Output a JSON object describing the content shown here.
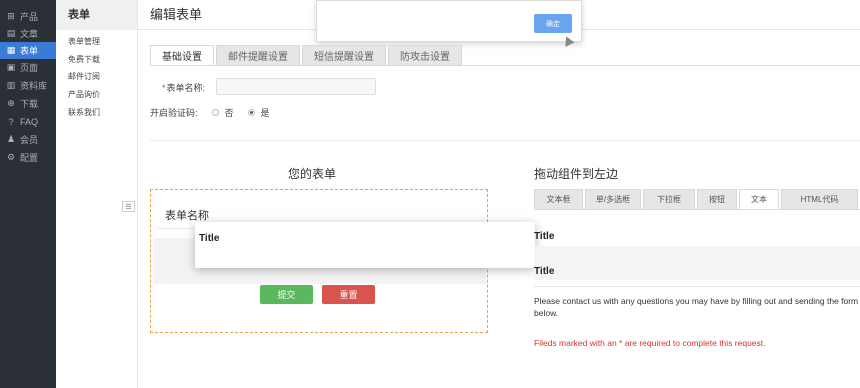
{
  "nav": {
    "items": [
      {
        "icon": "grid-icon",
        "label": "产品"
      },
      {
        "icon": "file-icon",
        "label": "文章"
      },
      {
        "icon": "form-icon",
        "label": "表单"
      },
      {
        "icon": "page-icon",
        "label": "页面"
      },
      {
        "icon": "folder-icon",
        "label": "资料库"
      },
      {
        "icon": "download-icon",
        "label": "下载"
      },
      {
        "icon": "faq-icon",
        "label": "FAQ"
      },
      {
        "icon": "member-icon",
        "label": "会员"
      },
      {
        "icon": "settings-icon",
        "label": "配置"
      }
    ],
    "active_color": "#3a7bd5"
  },
  "sidebar": {
    "header": "表单",
    "items": [
      "表单管理",
      "免费下载",
      "邮件订阅",
      "产品询价",
      "联系我们"
    ]
  },
  "header": {
    "title": "编辑表单"
  },
  "dialog": {
    "confirm_label": "确定"
  },
  "tabs": [
    "基础设置",
    "邮件提醒设置",
    "短信提醒设置",
    "防攻击设置"
  ],
  "form": {
    "name_label": "表单名称:",
    "name_value": "",
    "captcha_label": "开启验证码:",
    "captcha_options": [
      "否",
      "是"
    ],
    "captcha_selected": "是"
  },
  "your_form": {
    "heading": "您的表单",
    "form_name": "表单名称",
    "submit_label": "提交",
    "reset_label": "重置",
    "drag_preview_title": "Title"
  },
  "components": {
    "heading": "拖动组件到左边",
    "tabs": [
      "文本框",
      "单/多选框",
      "下拉框",
      "按钮",
      "文本",
      "HTML代码"
    ],
    "active_tab": "文本",
    "title1": "Title",
    "title2": "Title",
    "paragraph": "Please contact us with any questions you may have by filling out and sending the form below.",
    "required_note": "Fileds marked with an * are required to complete this request."
  }
}
